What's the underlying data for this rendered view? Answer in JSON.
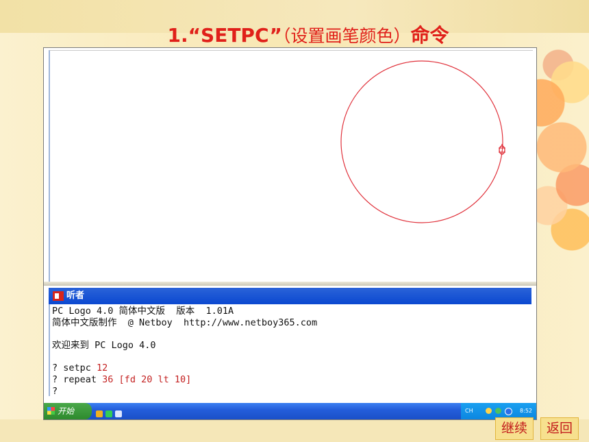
{
  "slide": {
    "title_main": "1.“SETPC”",
    "title_paren": "（设置画笔颜色）",
    "title_tail": "命令"
  },
  "logo": {
    "listener_title": "听者",
    "console_lines": [
      "PC Logo 4.0 简体中文版  版本  1.01A",
      "简体中文版制作  @ Netboy  http://www.netboy365.com",
      "",
      "欢迎来到 PC Logo 4.0",
      ""
    ],
    "commands": [
      {
        "prompt": "? ",
        "text": "setpc",
        "arg": " 12"
      },
      {
        "prompt": "? ",
        "text": "repeat",
        "arg": " 36 [fd 20 lt 10]"
      },
      {
        "prompt": "?",
        "text": "",
        "arg": ""
      }
    ],
    "pen_color": "#e0303a"
  },
  "taskbar": {
    "start_label": "开始",
    "ime": "CH",
    "clock": "8:52"
  },
  "nav": {
    "next_label": "继续",
    "back_label": "返回"
  },
  "colors": {
    "title_red": "#e0201a",
    "titlebar_blue": "#0b48d0",
    "button_bg": "#f7e08e"
  }
}
